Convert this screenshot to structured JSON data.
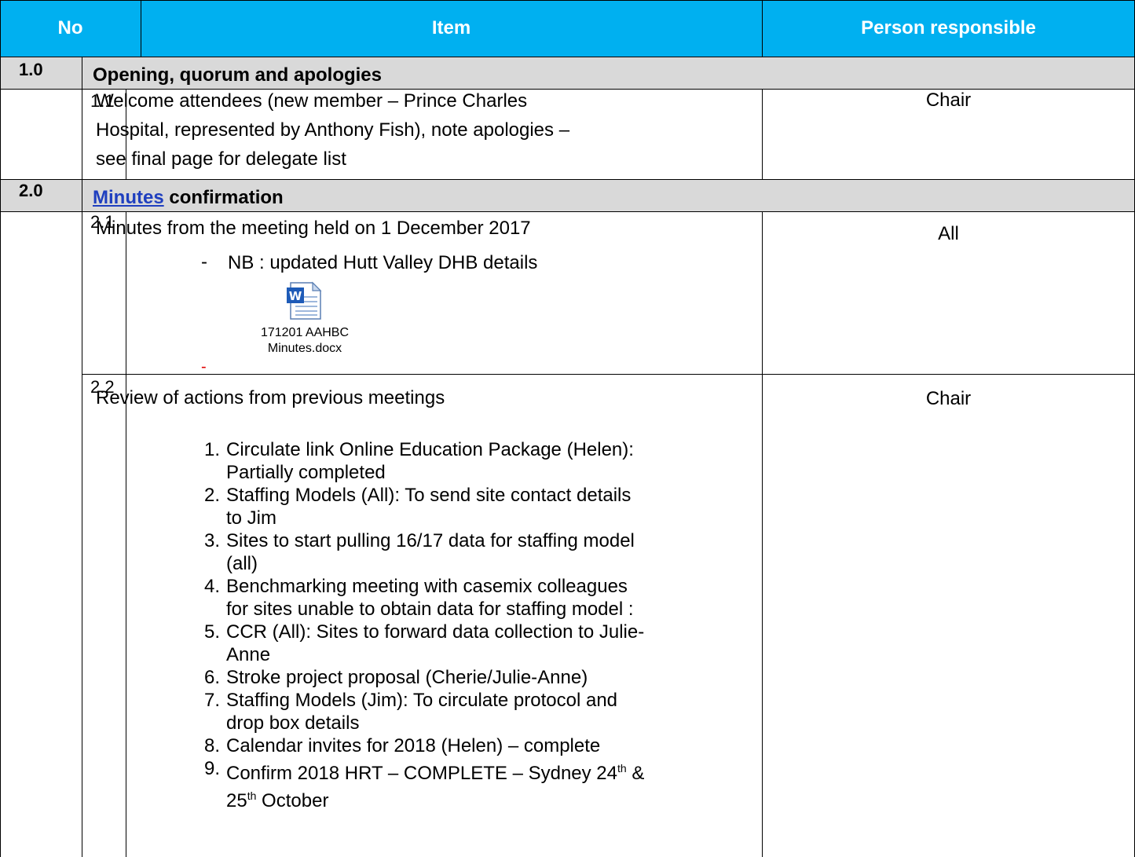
{
  "header": {
    "no": "No",
    "item": "Item",
    "person": "Person responsible",
    "bg_color": "#00B0F0"
  },
  "sections": [
    {
      "no": "1.0",
      "title": "Opening, quorum and apologies",
      "items": [
        {
          "no": "1.1",
          "lines": [
            "Welcome attendees (new member – Prince Charles",
            "Hospital, represented by Anthony Fish), note apologies –",
            "see final page for delegate list"
          ],
          "person": "Chair"
        }
      ]
    },
    {
      "no": "2.0",
      "title_link": "Minutes",
      "title_rest": " confirmation",
      "items": [
        {
          "no": "2.1",
          "text": "Minutes from the meeting held on 1 December  2017",
          "bullet_marker": "-",
          "bullet": "NB : updated Hutt Valley DHB details",
          "attachment_line1": "171201 AAHBC",
          "attachment_line2": "Minutes.docx",
          "trailing_dash": "-",
          "person": "All"
        },
        {
          "no": "2.2",
          "text": "Review of actions from previous meetings",
          "person": "Chair",
          "actions": [
            {
              "n": "1.",
              "lines": [
                "Circulate link Online Education Package (Helen):",
                "Partially completed"
              ]
            },
            {
              "n": "2.",
              "lines": [
                "Staffing Models (All): To send site contact details",
                "to Jim"
              ]
            },
            {
              "n": "3.",
              "lines": [
                "Sites to start pulling 16/17 data for staffing model",
                "(all)"
              ]
            },
            {
              "n": "4.",
              "lines": [
                "Benchmarking meeting with casemix colleagues",
                "for sites unable to obtain data for staffing model :"
              ]
            },
            {
              "n": "5.",
              "lines": [
                "CCR (All): Sites to forward data collection to Julie-",
                "Anne"
              ]
            },
            {
              "n": "6.",
              "lines": [
                "Stroke project proposal (Cherie/Julie-Anne)"
              ]
            },
            {
              "n": "7.",
              "lines": [
                "Staffing Models (Jim): To circulate protocol and",
                "drop box details"
              ]
            },
            {
              "n": "8.",
              "lines": [
                "Calendar invites for 2018 (Helen) – complete"
              ]
            },
            {
              "n": "9.",
              "line1_a": "Confirm 2018 HRT – COMPLETE – Sydney 24",
              "sup1": "th",
              "line1_b": " &",
              "line2_a": "25",
              "sup2": "th",
              "line2_b": " October"
            }
          ]
        }
      ]
    }
  ],
  "colors": {
    "header_bg": "#00B0F0",
    "section_bg": "#D9D9D9",
    "link": "#1F3FBF",
    "dash_red": "#E00000"
  }
}
